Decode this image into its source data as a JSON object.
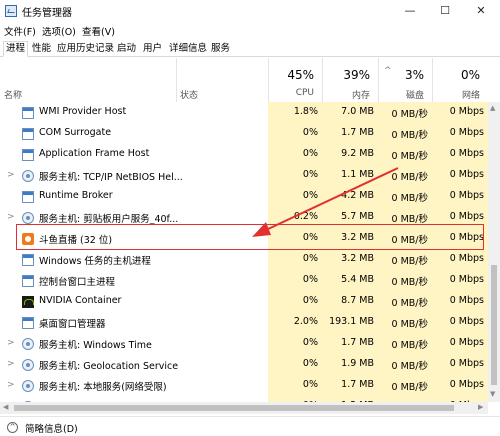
{
  "window": {
    "title": "任务管理器",
    "min": "—",
    "max": "☐",
    "close": "✕"
  },
  "menu": [
    "文件(F)",
    "选项(O)",
    "查看(V)"
  ],
  "tabs": [
    "进程",
    "性能",
    "应用历史记录",
    "启动",
    "用户",
    "详细信息",
    "服务"
  ],
  "header": {
    "name": "名称",
    "status": "状态",
    "cpu": {
      "pct": "45%",
      "label": "CPU"
    },
    "memory": {
      "pct": "39%",
      "label": "内存"
    },
    "disk": {
      "pct": "3%",
      "label": "磁盘"
    },
    "network": {
      "pct": "0%",
      "label": "网络"
    },
    "sort_arrow": "^"
  },
  "processes": [
    {
      "name": "WMI Provider Host",
      "icon": "service-window-icon",
      "expand": "",
      "cpu": "1.8%",
      "mem": "7.0 MB",
      "disk": "0 MB/秒",
      "net": "0 Mbps"
    },
    {
      "name": "COM Surrogate",
      "icon": "service-window-icon",
      "expand": "",
      "cpu": "0%",
      "mem": "1.7 MB",
      "disk": "0 MB/秒",
      "net": "0 Mbps"
    },
    {
      "name": "Application Frame Host",
      "icon": "service-window-icon",
      "expand": "",
      "cpu": "0%",
      "mem": "9.2 MB",
      "disk": "0 MB/秒",
      "net": "0 Mbps"
    },
    {
      "name": "服务主机: TCP/IP NetBIOS Hel...",
      "icon": "gear-icon",
      "expand": ">",
      "cpu": "0%",
      "mem": "1.1 MB",
      "disk": "0 MB/秒",
      "net": "0 Mbps"
    },
    {
      "name": "Runtime Broker",
      "icon": "service-window-icon",
      "expand": "",
      "cpu": "0%",
      "mem": "4.2 MB",
      "disk": "0 MB/秒",
      "net": "0 Mbps"
    },
    {
      "name": "服务主机: 剪贴板用户服务_40f...",
      "icon": "gear-icon",
      "expand": ">",
      "cpu": "0.2%",
      "mem": "5.7 MB",
      "disk": "0 MB/秒",
      "net": "0 Mbps"
    },
    {
      "name": "斗鱼直播 (32 位)",
      "icon": "douyu-icon",
      "expand": "",
      "cpu": "0%",
      "mem": "3.2 MB",
      "disk": "0 MB/秒",
      "net": "0 Mbps"
    },
    {
      "name": "Windows 任务的主机进程",
      "icon": "service-window-icon",
      "expand": "",
      "cpu": "0%",
      "mem": "3.2 MB",
      "disk": "0 MB/秒",
      "net": "0 Mbps"
    },
    {
      "name": "控制台窗口主进程",
      "icon": "service-window-icon",
      "expand": "",
      "cpu": "0%",
      "mem": "5.4 MB",
      "disk": "0 MB/秒",
      "net": "0 Mbps"
    },
    {
      "name": "NVIDIA Container",
      "icon": "nvidia-icon",
      "expand": "",
      "cpu": "0%",
      "mem": "8.7 MB",
      "disk": "0 MB/秒",
      "net": "0 Mbps"
    },
    {
      "name": "桌面窗口管理器",
      "icon": "service-window-icon",
      "expand": "",
      "cpu": "2.0%",
      "mem": "193.1 MB",
      "disk": "0 MB/秒",
      "net": "0 Mbps"
    },
    {
      "name": "服务主机: Windows Time",
      "icon": "gear-icon",
      "expand": ">",
      "cpu": "0%",
      "mem": "1.7 MB",
      "disk": "0 MB/秒",
      "net": "0 Mbps"
    },
    {
      "name": "服务主机: Geolocation Service",
      "icon": "gear-icon",
      "expand": ">",
      "cpu": "0%",
      "mem": "1.9 MB",
      "disk": "0 MB/秒",
      "net": "0 Mbps"
    },
    {
      "name": "服务主机: 本地服务(网络受限)",
      "icon": "gear-icon",
      "expand": ">",
      "cpu": "0%",
      "mem": "1.7 MB",
      "disk": "0 MB/秒",
      "net": "0 Mbps"
    },
    {
      "name": "服务主机: 本地系统",
      "icon": "gear-icon",
      "expand": ">",
      "cpu": "0%",
      "mem": "1.2 MB",
      "disk": "0 MB/秒",
      "net": "0 Mbps"
    }
  ],
  "footer": {
    "fewer_details": "简略信息(D)",
    "fewer_icon": "^"
  },
  "colors": {
    "highlight_border": "#e23030",
    "column_bg": "#fff4c4"
  }
}
